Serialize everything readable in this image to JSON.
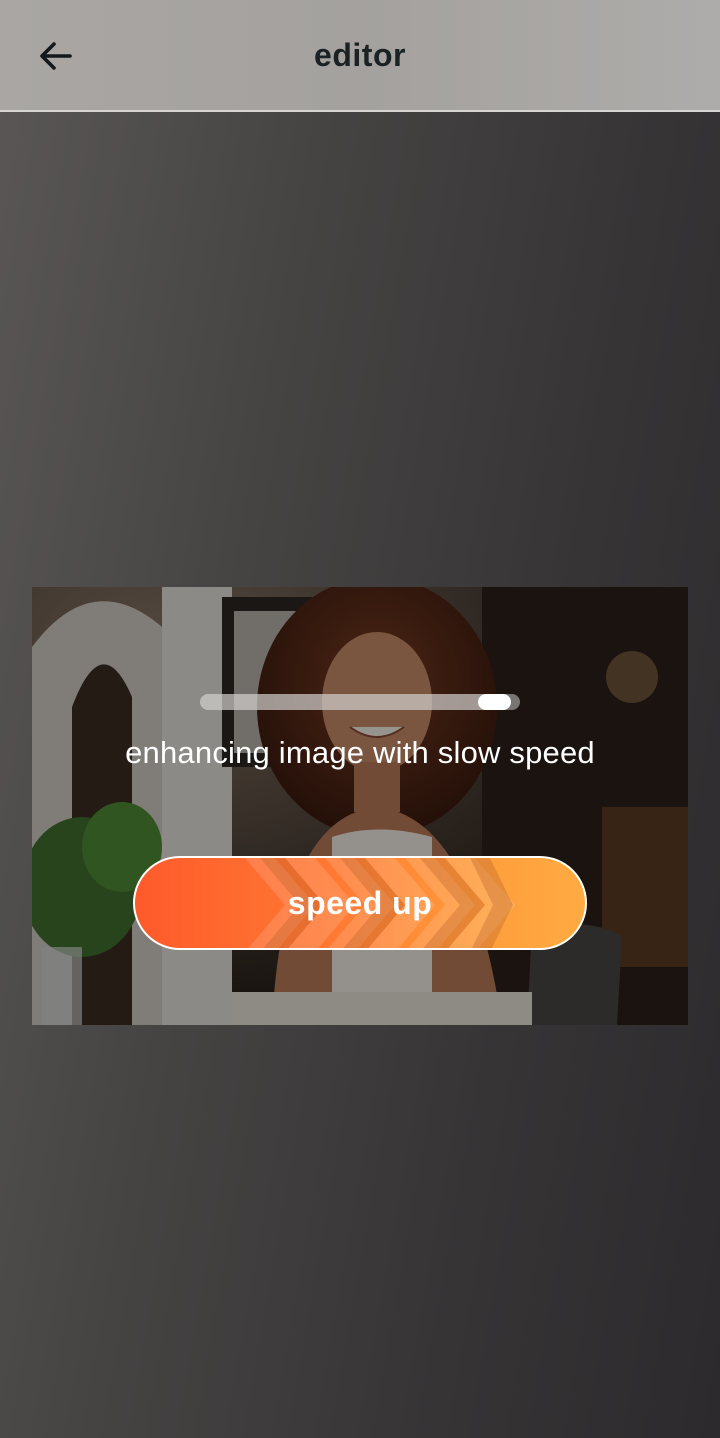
{
  "header": {
    "title": "editor",
    "back_icon": "arrow-left-icon"
  },
  "enhance": {
    "progress": 0.97,
    "status_text": "enhancing image with slow speed",
    "button_label": "speed up"
  },
  "colors": {
    "header_bg": "#a7a4a1",
    "title_color": "#1b2224",
    "button_start": "#ff5a2a",
    "button_end": "#ffaa42",
    "status_text": "#ffffff"
  }
}
